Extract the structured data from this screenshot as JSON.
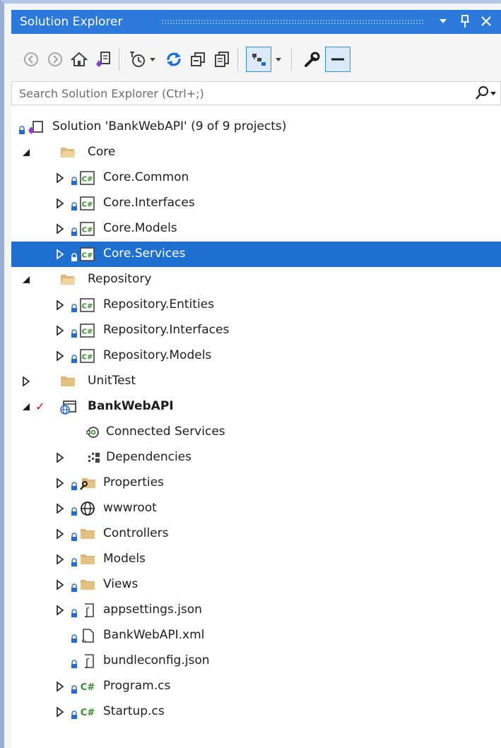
{
  "window": {
    "title": "Solution Explorer"
  },
  "search": {
    "placeholder": "Search Solution Explorer (Ctrl+;)"
  },
  "titlebar_buttons": [
    "dropdown-icon",
    "pin-icon",
    "close-icon"
  ],
  "toolbar": [
    "back-icon",
    "forward-icon",
    "home-icon",
    "switch-views-icon",
    "pending-changes-filter-icon",
    "sync-icon",
    "collapse-all-icon",
    "show-all-files-icon",
    "preview-selected-items-icon",
    "properties-icon",
    "preview-pane-icon"
  ],
  "tree": [
    {
      "label": "Solution 'BankWebAPI' (9 of 9 projects)",
      "icon": "solution-icon",
      "level": 0,
      "expander": "none",
      "lock": true
    },
    {
      "label": "Core",
      "icon": "folder-open-icon",
      "level": 1,
      "expander": "expanded",
      "lock": false
    },
    {
      "label": "Core.Common",
      "icon": "csharp-project-icon",
      "level": 2,
      "expander": "collapsed",
      "lock": true
    },
    {
      "label": "Core.Interfaces",
      "icon": "csharp-project-icon",
      "level": 2,
      "expander": "collapsed",
      "lock": true
    },
    {
      "label": "Core.Models",
      "icon": "csharp-project-icon",
      "level": 2,
      "expander": "collapsed",
      "lock": true
    },
    {
      "label": "Core.Services",
      "icon": "csharp-project-icon",
      "level": 2,
      "expander": "collapsed",
      "lock": true,
      "selected": true
    },
    {
      "label": "Repository",
      "icon": "folder-open-icon",
      "level": 1,
      "expander": "expanded",
      "lock": false
    },
    {
      "label": "Repository.Entities",
      "icon": "csharp-project-icon",
      "level": 2,
      "expander": "collapsed",
      "lock": true
    },
    {
      "label": "Repository.Interfaces",
      "icon": "csharp-project-icon",
      "level": 2,
      "expander": "collapsed",
      "lock": true
    },
    {
      "label": "Repository.Models",
      "icon": "csharp-project-icon",
      "level": 2,
      "expander": "collapsed",
      "lock": true
    },
    {
      "label": "UnitTest",
      "icon": "folder-icon",
      "level": 1,
      "expander": "collapsed",
      "lock": false
    },
    {
      "label": "BankWebAPI",
      "icon": "web-project-icon",
      "level": 1,
      "expander": "expanded",
      "lock": false,
      "bold": true,
      "check": true
    },
    {
      "label": "Connected Services",
      "icon": "connected-services-icon",
      "level": 2,
      "expander": "none",
      "lock": false
    },
    {
      "label": "Dependencies",
      "icon": "dependencies-icon",
      "level": 2,
      "expander": "collapsed",
      "lock": false
    },
    {
      "label": "Properties",
      "icon": "properties-folder-icon",
      "level": 2,
      "expander": "collapsed",
      "lock": true
    },
    {
      "label": "wwwroot",
      "icon": "globe-icon",
      "level": 2,
      "expander": "collapsed",
      "lock": true
    },
    {
      "label": "Controllers",
      "icon": "folder-icon",
      "level": 2,
      "expander": "collapsed",
      "lock": true
    },
    {
      "label": "Models",
      "icon": "folder-icon",
      "level": 2,
      "expander": "collapsed",
      "lock": true
    },
    {
      "label": "Views",
      "icon": "folder-icon",
      "level": 2,
      "expander": "collapsed",
      "lock": true
    },
    {
      "label": "appsettings.json",
      "icon": "json-file-icon",
      "level": 2,
      "expander": "collapsed",
      "lock": true
    },
    {
      "label": "BankWebAPI.xml",
      "icon": "xml-file-icon",
      "level": 2,
      "expander": "none",
      "lock": true
    },
    {
      "label": "bundleconfig.json",
      "icon": "json-file-icon",
      "level": 2,
      "expander": "none",
      "lock": true
    },
    {
      "label": "Program.cs",
      "icon": "csharp-file-icon",
      "level": 2,
      "expander": "collapsed",
      "lock": true
    },
    {
      "label": "Startup.cs",
      "icon": "csharp-file-icon",
      "level": 2,
      "expander": "collapsed",
      "lock": true
    }
  ],
  "colors": {
    "titlebar": "#2b79d8",
    "selection": "#1f6fcf",
    "folder": "#dcb67a",
    "csharp": "#388a34",
    "lock": "#2b6cc4"
  }
}
